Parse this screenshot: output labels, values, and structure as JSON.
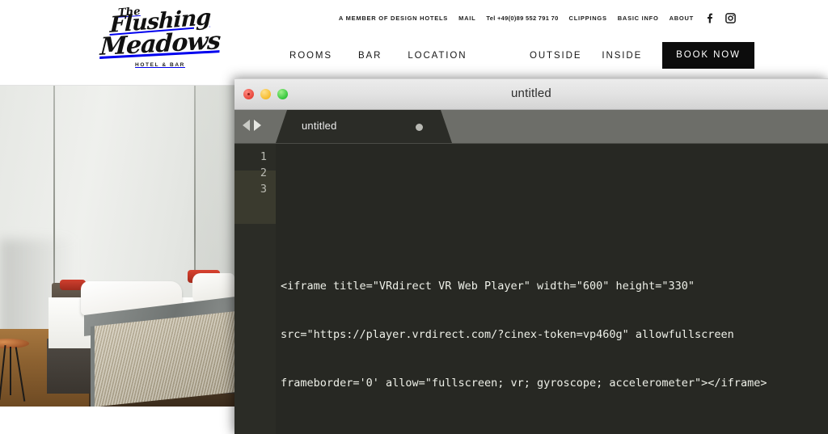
{
  "site": {
    "logo": {
      "the": "The",
      "line1": "Flushing",
      "line2": "Meadows",
      "subtitle": "HOTEL & BAR"
    },
    "utility_nav": [
      {
        "label": "A MEMBER OF DESIGN HOTELS",
        "name": "member-of-design-hotels"
      },
      {
        "label": "MAIL",
        "name": "mail"
      },
      {
        "label": "Tel +49(0)89 552 791 70",
        "name": "telephone"
      },
      {
        "label": "CLIPPINGS",
        "name": "clippings"
      },
      {
        "label": "BASIC INFO",
        "name": "basic-info"
      },
      {
        "label": "ABOUT",
        "name": "about"
      }
    ],
    "social": [
      {
        "name": "facebook-icon",
        "label": "Facebook"
      },
      {
        "name": "instagram-icon",
        "label": "Instagram"
      }
    ],
    "main_nav_left": [
      {
        "label": "ROOMS",
        "name": "rooms"
      },
      {
        "label": "BAR",
        "name": "bar"
      },
      {
        "label": "LOCATION",
        "name": "location"
      }
    ],
    "main_nav_right": [
      {
        "label": "OUTSIDE",
        "name": "outside"
      },
      {
        "label": "INSIDE",
        "name": "inside"
      }
    ],
    "book_now_label": "BOOK NOW",
    "hero_alt": "Hotel room with bed, white linens, red cushions and copper side table",
    "colors": {
      "accent_button_bg": "#0c0c0c",
      "accent_button_text": "#ffffff",
      "text": "#161616",
      "page_bg": "#ffffff"
    }
  },
  "editor": {
    "window_title": "untitled",
    "traffic_lights": [
      {
        "name": "close-button",
        "color": "#e8473c"
      },
      {
        "name": "minimize-button",
        "color": "#f6bc2e"
      },
      {
        "name": "maximize-button",
        "color": "#35c63c"
      }
    ],
    "tab_nav": {
      "prev_label": "Previous tab",
      "next_label": "Next tab"
    },
    "tabs": [
      {
        "label": "untitled",
        "modified": true,
        "active": true
      }
    ],
    "line_numbers": [
      "1",
      "2",
      "3"
    ],
    "code_lines": [
      "",
      "",
      "<iframe title=\"VRdirect VR Web Player\" width=\"600\" height=\"330\"",
      "src=\"https://player.vrdirect.com/?cinex-token=vp460g\" allowfullscreen",
      "frameborder='0' allow=\"fullscreen; vr; gyroscope; accelerometer\"></iframe>"
    ],
    "colors": {
      "editor_bg": "#272823",
      "gutter_bg": "#2b2c26",
      "gutter_active_bg": "#3a3a2e",
      "tabbar_bg": "#6d6e69",
      "active_tab_bg": "#2b2c27",
      "titlebar_bg": "#e2e2e2",
      "code_text": "#eef0e8",
      "line_number_text": "#b9bab2"
    }
  }
}
